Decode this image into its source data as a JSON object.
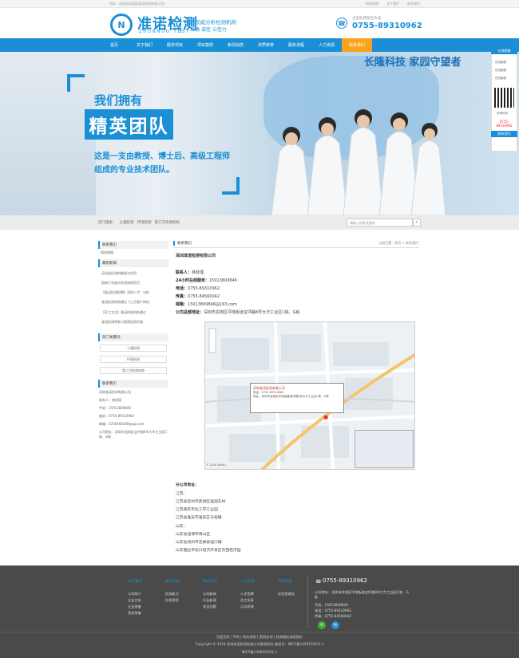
{
  "topbar": {
    "welcome": "您好，欢迎访问深圳准诺检测有限公司！",
    "links": [
      "网站地图",
      "关于我们",
      "联系我们"
    ]
  },
  "header": {
    "logo_mark": "N",
    "logo_cn": "准诺检测",
    "logo_en": "ZHUNNUO TEST",
    "slogan1": "国内权威分析检测机构",
    "slogan2": "准确 诚信 公信力",
    "hotline_label": "全国免费服务热线：",
    "hotline": "0755-89310962"
  },
  "nav": [
    "首页",
    "关于我们",
    "服务项目",
    "项目案例",
    "新闻动态",
    "资质荣誉",
    "服务流程",
    "人力资源",
    "联系我们"
  ],
  "hero": {
    "brand": "长隆科技 家园守望者",
    "line1": "我们拥有",
    "title": "精英团队",
    "line2": "这是一支由教授、博士后、高级工程师",
    "line3": "组成的专业技术团队。"
  },
  "float": {
    "head": "在线客服",
    "rows": [
      "在线客服",
      "在线客服",
      "在线客服"
    ],
    "qr_label": "咨询热线",
    "phone": "0755-89310962",
    "foot": "联系我们"
  },
  "crumbbar": {
    "label": "热门搜索：",
    "items": [
      "土壤检测",
      "环境检测",
      "第三方检测机构"
    ],
    "search_placeholder": "请输入搜索关键词"
  },
  "sidebar": {
    "contact_head": "联系我们",
    "contact_sub": "网站地图",
    "news_head": "最新新闻",
    "news": [
      "无机盐检测的概述与作用",
      "固体行业废水检测流程项目",
      "【准诺检测招聘】深圳人才：分检",
      "准诺检测机构通过《三方案产体检",
      "【开工大吉】准诺检测机构通过",
      "准诺检测将参与国家检测开展"
    ],
    "keywords_head": "热门关键词",
    "keywords": [
      "土壤检测",
      "环境检测",
      "第三方检测机构"
    ],
    "company_head": "联系我们",
    "company_lines": [
      "深圳准诺检测有限公司",
      "联系人：林经理",
      "手机：15013809846",
      "座机：0755-89310962",
      "邮箱：2250468268@qq.com",
      "公司地址：深圳市龙岗区宝坪路8号大华工业区C栋、G栋"
    ]
  },
  "main": {
    "title": "联系我们",
    "crumb": "当前位置：首页 > 联系我们",
    "company": "深圳准诺检测有限公司",
    "info": [
      {
        "label": "联系人：",
        "value": "林经理"
      },
      {
        "label": "24小时在线服务：",
        "value": "15013809846"
      },
      {
        "label": "电话：",
        "value": "0755-89310962"
      },
      {
        "label": "传真：",
        "value": "0755-84560042"
      },
      {
        "label": "邮箱：",
        "value": "15013809846@163.com"
      },
      {
        "label": "公司总部地址：",
        "value": "深圳市龙岗区坪地街道宝坪路8号大华工业区C栋、G栋"
      }
    ],
    "map": {
      "popup_title": "深圳准诺检测有限公司",
      "popup_lines": [
        "电话：0755-89310962",
        "地址：深圳市龙岗区坪地街道宝坪路8号大华工业区C栋、G栋"
      ],
      "scale": "© 2018 Baidu"
    },
    "branch_head": "分公司地址：",
    "branches": [
      "江苏：",
      "江苏省常州市武进区遥观东村",
      "江苏南京市化工学工业园",
      "江苏省淮安市淮安区马甸镇",
      "山东：",
      "山东省淄博市博山区",
      "山东省滨州市无棣县埕口镇",
      "山东烟台市龙口经济开发区东西经济园"
    ]
  },
  "footer": {
    "cols": [
      {
        "head": "关于我们",
        "items": [
          "公司简介",
          "企业文化",
          "企业荣誉",
          "资质荣誉"
        ]
      },
      {
        "head": "服务项目",
        "items": [
          "检测能力",
          "检测项目"
        ]
      },
      {
        "head": "新闻资讯",
        "items": [
          "公司新闻",
          "行业新闻",
          "常见问题"
        ]
      },
      {
        "head": "人力资源",
        "items": [
          "人才招聘",
          "员工风采",
          "公司环境"
        ]
      },
      {
        "head": "资质荣誉",
        "items": [
          "实验室建设"
        ]
      }
    ],
    "phone": "0755-89310962",
    "addr": [
      "公司地址：深圳市龙岗区坪地街道宝坪路8号大华工业区C栋、G栋",
      "手机：15013809846",
      "电话：0755-89310962",
      "传真：0755-84560042"
    ],
    "links": "百度百科 | FAQ | 网站地图 | 案例咨询 | 检测服务流程报价",
    "copy": "Copyright © 2018 深圳准诺检测有限公司版权所有 备案号：粤ICP备14091930号-1",
    "icp": "粤ICP备14091930号-1"
  }
}
